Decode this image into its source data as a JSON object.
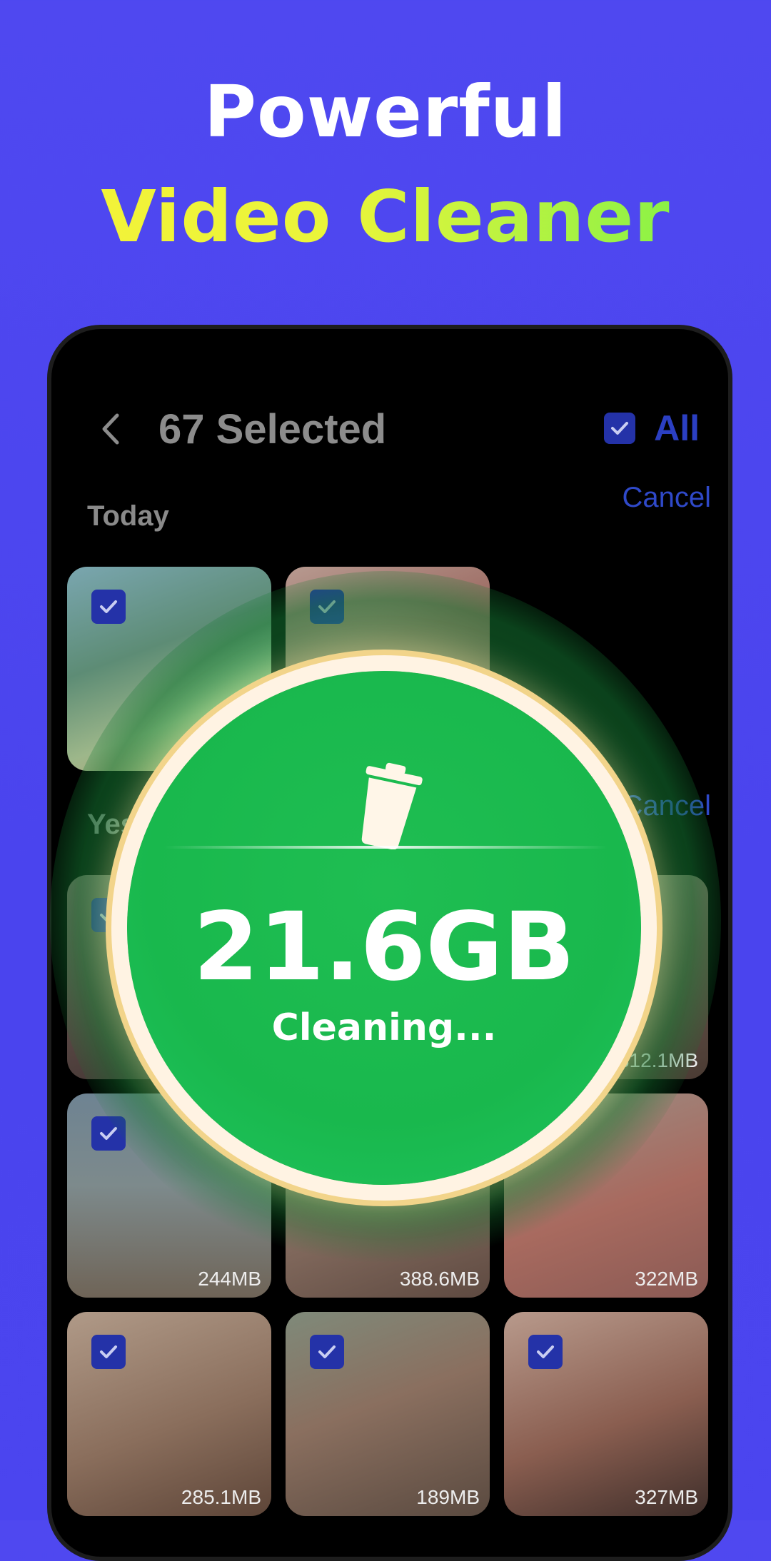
{
  "promo": {
    "line1": "Powerful",
    "line2": "Video Cleaner"
  },
  "header": {
    "title": "67 Selected",
    "select_all_label": "All"
  },
  "sections": [
    {
      "label": "Today",
      "action": "Cancel"
    },
    {
      "label": "Yesterday",
      "action": "Cancel"
    }
  ],
  "videos": [
    {
      "size": "",
      "checked": true
    },
    {
      "size": "",
      "checked": true
    },
    {
      "size": "",
      "checked": true
    },
    {
      "size": "",
      "checked": true
    },
    {
      "size": "312.1MB",
      "checked": true
    },
    {
      "size": "244MB",
      "checked": true
    },
    {
      "size": "388.6MB",
      "checked": true
    },
    {
      "size": "322MB",
      "checked": true
    },
    {
      "size": "285.1MB",
      "checked": true
    },
    {
      "size": "189MB",
      "checked": true
    },
    {
      "size": "327MB",
      "checked": true
    }
  ],
  "cleaner": {
    "amount": "21.6GB",
    "status": "Cleaning..."
  },
  "colors": {
    "background": "#4f48f0",
    "accent_yellow": "#f6f238",
    "accent_green": "#6ef04a",
    "check_blue": "#2432a8",
    "cleaner_green": "#1fbe52"
  },
  "icons": [
    "back-icon",
    "checkbox-checked-icon",
    "trash-icon"
  ]
}
